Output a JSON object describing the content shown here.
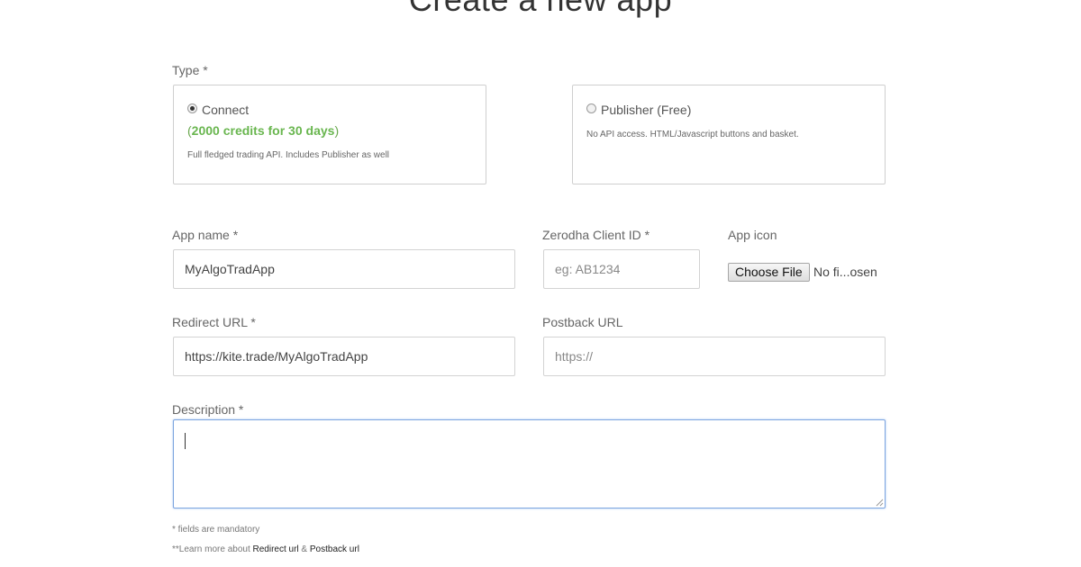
{
  "page": {
    "title": "Create a new app"
  },
  "type_section": {
    "label": "Type *",
    "connect": {
      "label": "Connect",
      "credits_open": "(",
      "credits_text": "2000 credits for 30 days",
      "credits_close": ")",
      "description": "Full fledged trading API. Includes Publisher as well",
      "selected": true
    },
    "publisher": {
      "label": "Publisher (Free)",
      "description": "No API access. HTML/Javascript buttons and basket.",
      "selected": false
    }
  },
  "form": {
    "app_name": {
      "label": "App name *",
      "value": "MyAlgoTradApp"
    },
    "client_id": {
      "label": "Zerodha Client ID *",
      "placeholder": "eg: AB1234"
    },
    "app_icon": {
      "label": "App icon",
      "button": "Choose File",
      "status": "No fi...osen"
    },
    "redirect_url": {
      "label": "Redirect URL *",
      "value": "https://kite.trade/MyAlgoTradApp"
    },
    "postback_url": {
      "label": "Postback URL",
      "placeholder": "https://"
    },
    "description": {
      "label": "Description *",
      "value": ""
    }
  },
  "notes": {
    "mandatory": "* fields are mandatory",
    "learn_prefix": "**Learn more about ",
    "redirect_link": "Redirect url",
    "separator": " & ",
    "postback_link": "Postback url"
  },
  "colors": {
    "accent_green": "#6aa84f",
    "focus_blue": "#7ea6e0",
    "border_gray": "#cfcfcf"
  }
}
